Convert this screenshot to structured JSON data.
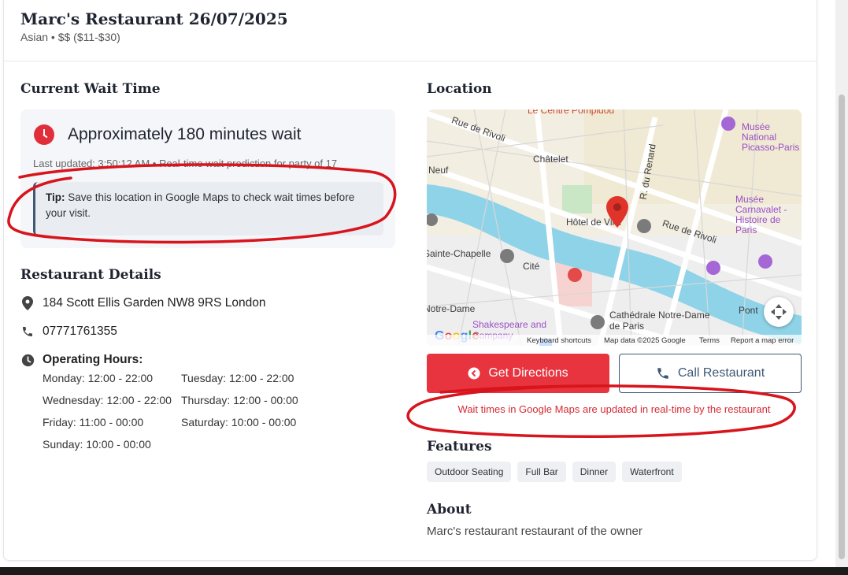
{
  "header": {
    "title": "Marc's Restaurant 26/07/2025",
    "subtitle": "Asian • $$ ($11-$30)"
  },
  "wait": {
    "section_title": "Current Wait Time",
    "main": "Approximately 180 minutes wait",
    "updated": "Last updated: 3:50:12 AM • Real-time wait prediction for party of 17",
    "tip_label": "Tip:",
    "tip_text": "Save this location in Google Maps to check wait times before your visit."
  },
  "details": {
    "section_title": "Restaurant Details",
    "address": "184 Scott Ellis Garden NW8 9RS London",
    "phone": "07771761355",
    "hours_title": "Operating Hours:",
    "hours": [
      "Monday: 12:00 - 22:00",
      "Tuesday: 12:00 - 22:00",
      "Wednesday: 12:00 - 22:00",
      "Thursday: 12:00 - 00:00",
      "Friday: 11:00 - 00:00",
      "Saturday: 10:00 - 00:00",
      "Sunday: 10:00 - 00:00"
    ]
  },
  "location": {
    "section_title": "Location",
    "map_labels": {
      "pompidou": "Le Centre Pompidou",
      "rivoli_top": "Rue de Rivoli",
      "chatelet": "Châtelet",
      "renard": "R. du Renard",
      "picasso": "Musée National Picasso-Paris",
      "neuf": "Neuf",
      "hotel_ville": "Hôtel de Ville",
      "rivoli_right": "Rue de Rivoli",
      "carnavalet": "Musée Carnavalet - Histoire de Paris",
      "chapelle": "Sainte-Chapelle",
      "cite": "Cité",
      "notre_dame_left": "Notre-Dame",
      "cathedrale": "Cathédrale Notre-Dame de Paris",
      "pont": "Pont",
      "shakespeare": "Shakespeare and Company",
      "google": "Google"
    },
    "footer": {
      "shortcuts": "Keyboard shortcuts",
      "mapdata": "Map data ©2025 Google",
      "terms": "Terms",
      "report": "Report a map error"
    }
  },
  "actions": {
    "directions": "Get Directions",
    "call": "Call Restaurant",
    "note": "Wait times in Google Maps are updated in real-time by the restaurant"
  },
  "features": {
    "section_title": "Features",
    "tags": [
      "Outdoor Seating",
      "Full Bar",
      "Dinner",
      "Waterfront"
    ]
  },
  "about": {
    "section_title": "About",
    "text": "Marc's restaurant restaurant of the owner"
  },
  "colors": {
    "accent_red": "#e8343f",
    "navy": "#3f5873",
    "annotation_red": "#d8141c"
  }
}
